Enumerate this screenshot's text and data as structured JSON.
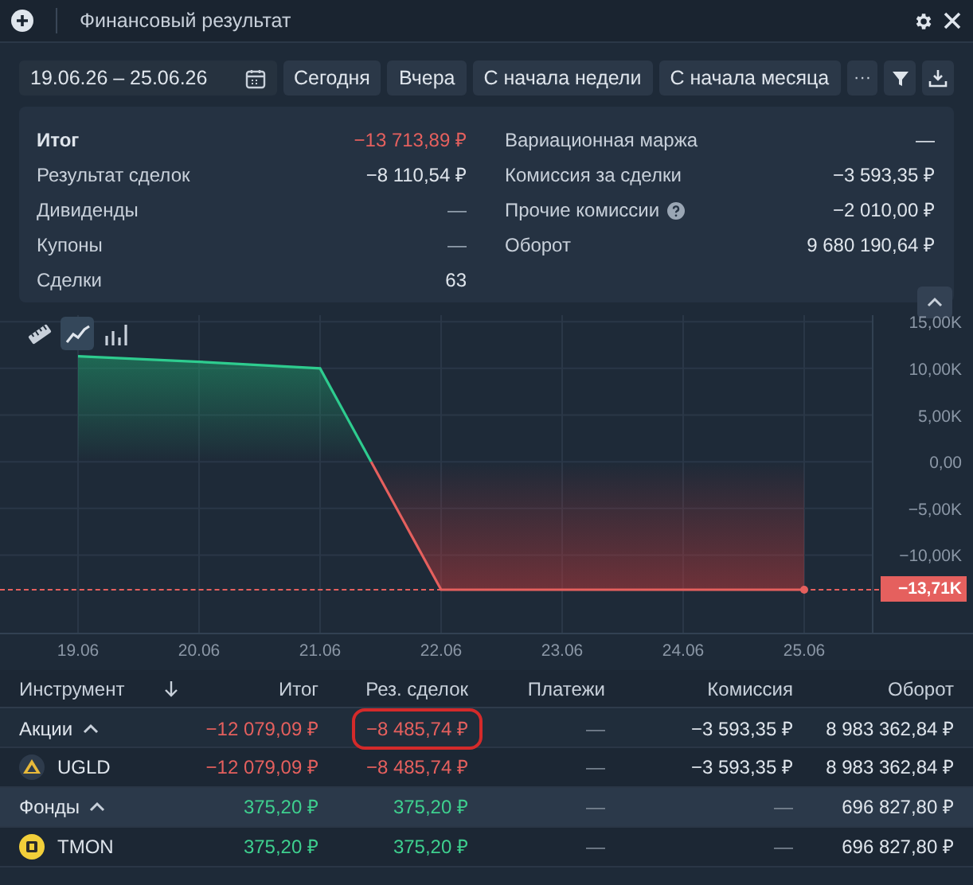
{
  "window": {
    "title": "Финансовый результат"
  },
  "toolbar": {
    "date_range": "19.06.26 – 25.06.26",
    "presets": [
      "Сегодня",
      "Вчера",
      "С начала недели",
      "С начала месяца"
    ],
    "more": "···"
  },
  "summary": {
    "left": [
      {
        "label": "Итог",
        "value": "−13 713,89 ₽",
        "bold": true,
        "color": "#e5605e"
      },
      {
        "label": "Результат сделок",
        "value": "−8 110,54 ₽",
        "bold": false,
        "color": "#dfe5ec"
      },
      {
        "label": "Дивиденды",
        "value": "—",
        "bold": false,
        "color": "#9aa6b4"
      },
      {
        "label": "Купоны",
        "value": "—",
        "bold": false,
        "color": "#9aa6b4"
      },
      {
        "label": "Сделки",
        "value": "63",
        "bold": false,
        "color": "#dfe5ec"
      }
    ],
    "right": [
      {
        "label": "Вариационная маржа",
        "value": "—",
        "help": false
      },
      {
        "label": "Комиссия за сделки",
        "value": "−3 593,35 ₽",
        "help": false
      },
      {
        "label": "Прочие комиссии",
        "value": "−2 010,00 ₽",
        "help": true
      },
      {
        "label": "Оборот",
        "value": "9 680 190,64 ₽",
        "help": false
      }
    ],
    "expanded": true
  },
  "chart_tools": [
    {
      "kind": "ruler",
      "selected": false
    },
    {
      "kind": "line",
      "selected": true
    },
    {
      "kind": "bars",
      "selected": false
    }
  ],
  "chart": {
    "chart_data": {
      "type": "area",
      "categories": [
        "19.06",
        "20.06",
        "21.06",
        "22.06",
        "23.06",
        "24.06",
        "25.06"
      ],
      "series": [
        {
          "color": "#2ecc8f",
          "values": [
            11300,
            10700,
            10000,
            -13710,
            -13710,
            -13710,
            -13710
          ]
        }
      ],
      "ylim": [
        -18400,
        15700
      ],
      "grid": true,
      "yticks": [
        {
          "value": 15000,
          "label": "15,00K"
        },
        {
          "value": 10000,
          "label": "10,00K"
        },
        {
          "value": 5000,
          "label": "5,00K"
        },
        {
          "value": 0,
          "label": "0,00"
        },
        {
          "value": -5000,
          "label": "−5,00K"
        },
        {
          "value": -10000,
          "label": "−10,00K"
        }
      ]
    },
    "current_value": {
      "label": "−13,71K"
    }
  },
  "table": {
    "name_column": "Инструмент",
    "columns": [
      "Итог",
      "Рез. сделок",
      "Платежи",
      "Комиссия",
      "Оборот"
    ],
    "rows": [
      {
        "kind": "group",
        "name": "Акции",
        "expanded": true,
        "cells": [
          {
            "text": "−12 079,09 ₽",
            "color": "#e5605e"
          },
          {
            "text": "−8 485,74 ₽",
            "color": "#e5605e",
            "circled": true
          },
          {
            "text": "—",
            "color": "#7d8896"
          },
          {
            "text": "−3 593,35 ₽",
            "color": "#dfe5ec"
          },
          {
            "text": "8 983 362,84 ₽",
            "color": "#dfe5ec"
          }
        ]
      },
      {
        "kind": "stock",
        "name": "UGLD",
        "cells": [
          {
            "text": "−12 079,09 ₽",
            "color": "#e5605e"
          },
          {
            "text": "−8 485,74 ₽",
            "color": "#e5605e",
            "circled": false
          },
          {
            "text": "—",
            "color": "#7d8896"
          },
          {
            "text": "−3 593,35 ₽",
            "color": "#dfe5ec"
          },
          {
            "text": "8 983 362,84 ₽",
            "color": "#dfe5ec"
          }
        ]
      },
      {
        "kind": "group",
        "name": "Фонды",
        "expanded": true,
        "cells": [
          {
            "text": "375,20 ₽",
            "color": "#3ed08f"
          },
          {
            "text": "375,20 ₽",
            "color": "#3ed08f",
            "circled": false
          },
          {
            "text": "—",
            "color": "#7d8896"
          },
          {
            "text": "—",
            "color": "#7d8896"
          },
          {
            "text": "696 827,80 ₽",
            "color": "#dfe5ec"
          }
        ]
      },
      {
        "kind": "fund",
        "name": "TMON",
        "cells": [
          {
            "text": "375,20 ₽",
            "color": "#3ed08f"
          },
          {
            "text": "375,20 ₽",
            "color": "#3ed08f",
            "circled": false
          },
          {
            "text": "—",
            "color": "#7d8896"
          },
          {
            "text": "—",
            "color": "#7d8896"
          },
          {
            "text": "696 827,80 ₽",
            "color": "#dfe5ec"
          }
        ]
      }
    ]
  }
}
